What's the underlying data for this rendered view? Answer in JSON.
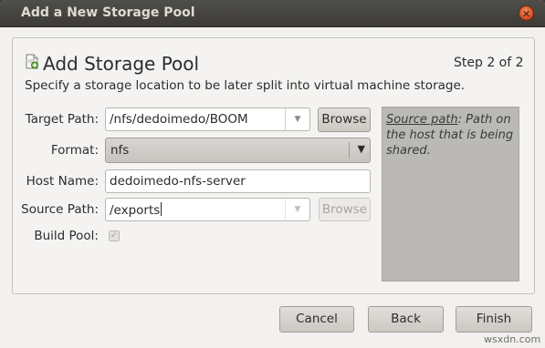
{
  "window": {
    "title": "Add a New Storage Pool",
    "close_glyph": "✕"
  },
  "header": {
    "icon": "storage-pool-add-icon",
    "title": "Add Storage Pool",
    "step": "Step 2 of 2",
    "description": "Specify a storage location to be later split into virtual machine storage."
  },
  "form": {
    "target_path": {
      "label": "Target Path:",
      "value": "/nfs/dedoimedo/BOOM",
      "browse_label": "Browse"
    },
    "format": {
      "label": "Format:",
      "value": "nfs"
    },
    "host_name": {
      "label": "Host Name:",
      "value": "dedoimedo-nfs-server"
    },
    "source_path": {
      "label": "Source Path:",
      "value": "/exports",
      "browse_label": "Browse",
      "browse_enabled": false
    },
    "build_pool": {
      "label": "Build Pool:",
      "checked": true,
      "enabled": false
    }
  },
  "help": {
    "term": "Source path",
    "text": ": Path on the host that is being shared."
  },
  "footer": {
    "cancel_label": "Cancel",
    "back_label": "Back",
    "finish_label": "Finish"
  },
  "watermark": "wsxdn.com"
}
